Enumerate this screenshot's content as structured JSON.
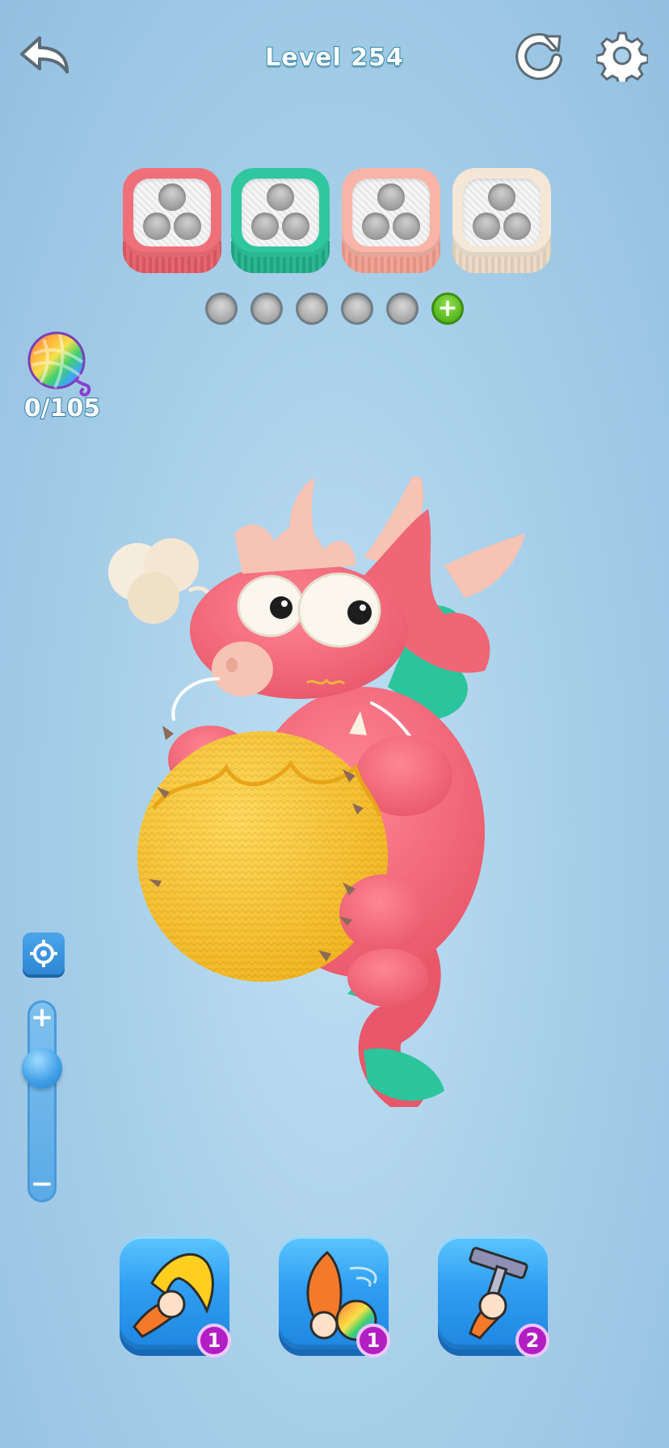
{
  "header": {
    "back_icon": "back-arrow-icon",
    "level_title": "Level 254",
    "restart_icon": "restart-icon",
    "settings_icon": "gear-icon"
  },
  "spool_boxes": [
    {
      "color": "#f0707a",
      "base_color": "#e25a66",
      "holes_filled": 0
    },
    {
      "color": "#2fc7a0",
      "base_color": "#1fae88",
      "holes_filled": 0
    },
    {
      "color": "#f8b4a6",
      "base_color": "#f09c8c",
      "holes_filled": 0
    },
    {
      "color": "#f4e7d6",
      "base_color": "#ead9c2",
      "holes_filled": 0
    }
  ],
  "slots": {
    "empty_count": 5,
    "add_icon": "plus-icon",
    "add_label": "+"
  },
  "yarn_progress": {
    "icon": "yarn-ball-icon",
    "count_text": "0/105",
    "current": 0,
    "total": 105
  },
  "zoom": {
    "target_icon": "crosshair-icon",
    "plus_label": "+",
    "minus_label": "−",
    "level": 0.85
  },
  "boosters": [
    {
      "name": "hook-booster",
      "icon": "hook-icon",
      "count": "1"
    },
    {
      "name": "yarn-throw-booster",
      "icon": "yarn-throw-icon",
      "count": "1"
    },
    {
      "name": "rake-booster",
      "icon": "rake-icon",
      "count": "2"
    }
  ],
  "scene": {
    "subject": "knitted-dragon",
    "colors": {
      "body": "#f26a7b",
      "ball": "#f8c73a",
      "fin": "#2cc49c",
      "horn": "#f6c3b4"
    }
  }
}
